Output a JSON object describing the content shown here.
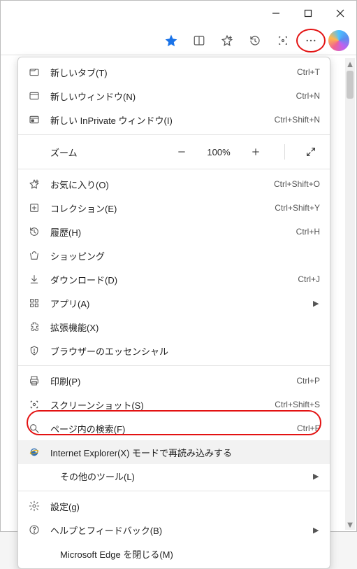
{
  "titlebar": {
    "min": "minimize",
    "max": "maximize",
    "close": "close"
  },
  "toolbar": {
    "star": "favorite-star",
    "split": "split-screen",
    "favadd": "add-favorite",
    "history": "history",
    "capture": "web-capture",
    "more": "settings-and-more",
    "copilot": "copilot"
  },
  "zoom": {
    "label": "ズーム",
    "value": "100%"
  },
  "menu": [
    {
      "icon": "tab",
      "label": "新しいタブ(T)",
      "shortcut": "Ctrl+T"
    },
    {
      "icon": "window",
      "label": "新しいウィンドウ(N)",
      "shortcut": "Ctrl+N"
    },
    {
      "icon": "inprivate",
      "label": "新しい InPrivate ウィンドウ(I)",
      "shortcut": "Ctrl+Shift+N"
    },
    {
      "sep": true
    },
    {
      "zoom": true
    },
    {
      "sep": true
    },
    {
      "icon": "star",
      "label": "お気に入り(O)",
      "shortcut": "Ctrl+Shift+O"
    },
    {
      "icon": "collections",
      "label": "コレクション(E)",
      "shortcut": "Ctrl+Shift+Y"
    },
    {
      "icon": "history",
      "label": "履歴(H)",
      "shortcut": "Ctrl+H"
    },
    {
      "icon": "shopping",
      "label": "ショッピング"
    },
    {
      "icon": "download",
      "label": "ダウンロード(D)",
      "shortcut": "Ctrl+J"
    },
    {
      "icon": "apps",
      "label": "アプリ(A)",
      "sub": true
    },
    {
      "icon": "extensions",
      "label": "拡張機能(X)"
    },
    {
      "icon": "essentials",
      "label": "ブラウザーのエッセンシャル"
    },
    {
      "sep": true
    },
    {
      "icon": "print",
      "label": "印刷(P)",
      "shortcut": "Ctrl+P"
    },
    {
      "icon": "screenshot",
      "label": "スクリーンショット(S)",
      "shortcut": "Ctrl+Shift+S"
    },
    {
      "icon": "find",
      "label": "ページ内の検索(F)",
      "shortcut": "Ctrl+F"
    },
    {
      "icon": "ie",
      "label": "Internet Explorer(X) モードで再読み込みする",
      "hover": true
    },
    {
      "indent": true,
      "label": "その他のツール(L)",
      "sub": true
    },
    {
      "sep": true
    },
    {
      "icon": "settings",
      "label": "設定(g)"
    },
    {
      "icon": "help",
      "label": "ヘルプとフィードバック(B)",
      "sub": true
    },
    {
      "indent": true,
      "label": "Microsoft Edge を閉じる(M)"
    }
  ]
}
